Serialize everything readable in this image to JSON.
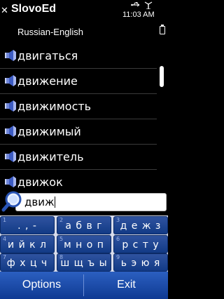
{
  "status": {
    "app_title": "SlovoEd",
    "close_glyph": "✕",
    "time": "11:03 AM"
  },
  "dictionary": "Russian-English",
  "words": [
    "двигаться",
    "движение",
    "движимость",
    "движимый",
    "движитель",
    "движок"
  ],
  "search": {
    "value": "движ"
  },
  "keypad": {
    "keys": [
      {
        "num": "1",
        "label": ". , -"
      },
      {
        "num": "2",
        "label": "а б в г"
      },
      {
        "num": "3",
        "label": "д е ж з"
      },
      {
        "num": "4",
        "label": "и й к л"
      },
      {
        "num": "5",
        "label": "м н о п"
      },
      {
        "num": "6",
        "label": "р с т у"
      },
      {
        "num": "7",
        "label": "ф х ц ч"
      },
      {
        "num": "8",
        "label": "ш щ ъ ы"
      },
      {
        "num": "9",
        "label": "ь э ю я"
      }
    ]
  },
  "softkeys": {
    "left": "Options",
    "right": "Exit"
  },
  "colors": {
    "softkey_bg": "#1e4aa8",
    "key_bg": "#1f4690",
    "keypad_bg": "#d8dcec"
  }
}
